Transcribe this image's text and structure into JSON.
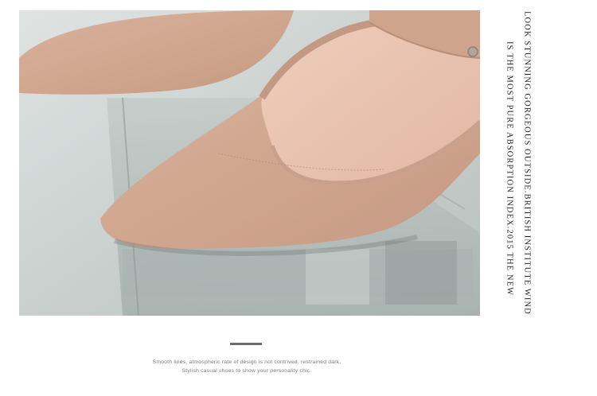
{
  "vertical_text": {
    "line1": "LOOK STUNNING GORGEOUS OUTSIDE.BRITISH INSTITUTE WIND",
    "line2": "IS THE MOST PURE ABSORPTION INDEX.2015 THE NEW"
  },
  "caption": {
    "line1": "Smooth lines, atmospheric rate of design is not contrived, restrained dark,",
    "line2": "Stylish casual shoes to show your personality chic."
  },
  "colors": {
    "suede": "#d8b09a",
    "lining": "#e9c3b0",
    "background": "#ffffff"
  }
}
